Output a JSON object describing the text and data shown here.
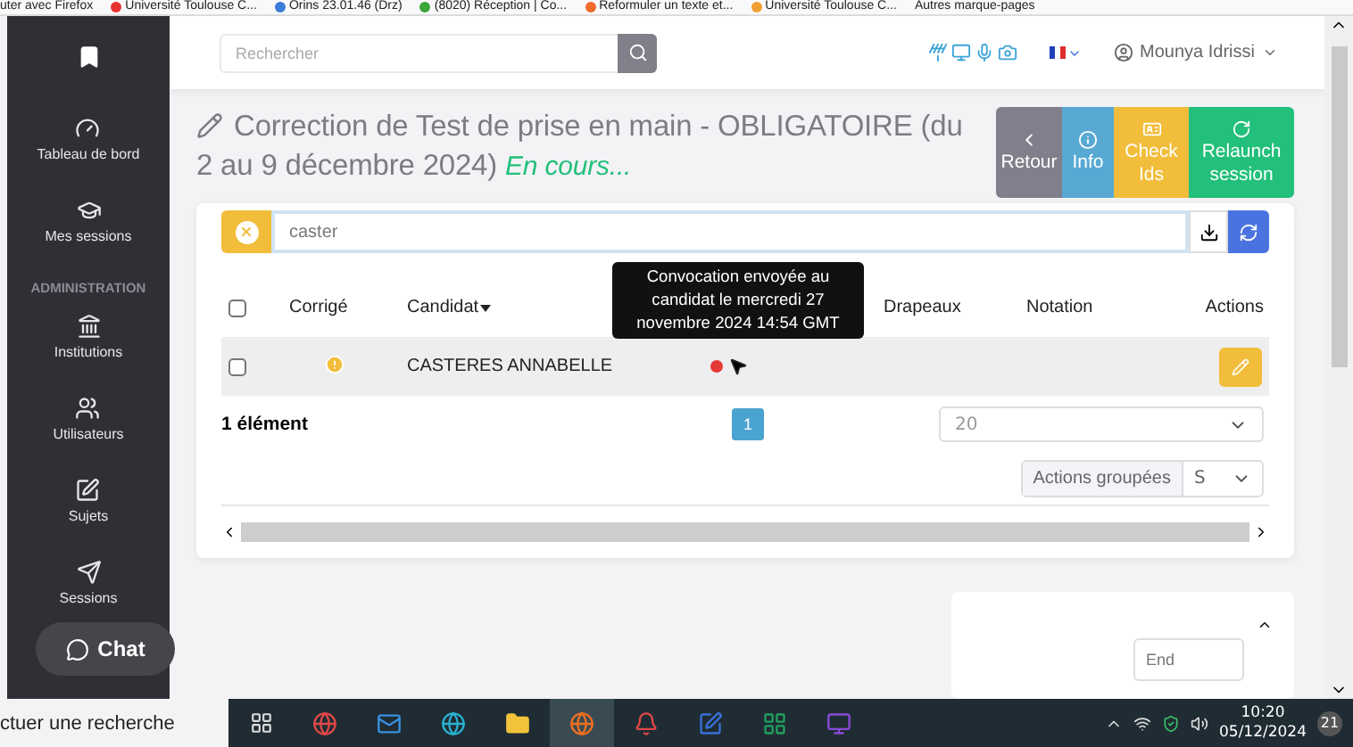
{
  "bookmarks": [
    {
      "label": "uter avec Firefox"
    },
    {
      "label": "Université Toulouse C...",
      "color": "#e5322d"
    },
    {
      "label": "Orins 23.01.46 (Drz)",
      "color": "#3b7dd8"
    },
    {
      "label": "(8020) Réception | Co...",
      "color": "#3aa63a"
    },
    {
      "label": "Reformuler un texte et...",
      "color": "#f06a2a"
    },
    {
      "label": "Université Toulouse C...",
      "color": "#f0a030"
    },
    {
      "label": "Autres marque-pages"
    }
  ],
  "header": {
    "search": {
      "placeholder": "Rechercher"
    },
    "user": "Mounya Idrissi"
  },
  "sidebar": {
    "items": [
      {
        "label": "Tableau de bord"
      },
      {
        "label": "Mes sessions"
      }
    ],
    "section": "ADMINISTRATION",
    "admin_items": [
      {
        "label": "Institutions"
      },
      {
        "label": "Utilisateurs"
      },
      {
        "label": "Sujets"
      },
      {
        "label": "Sessions"
      }
    ],
    "chat": "Chat"
  },
  "page": {
    "title": "Correction de Test de prise en main - OBLIGATOIRE (du 2 au 9 décembre 2024)",
    "status": "En cours...",
    "buttons": [
      {
        "label": "Retour",
        "kind": "back"
      },
      {
        "label": "Info",
        "kind": "info"
      },
      {
        "label": "Check Ids",
        "kind": "ids"
      },
      {
        "label": "Relaunch session",
        "kind": "relaunch"
      }
    ]
  },
  "filter": {
    "value": "caster"
  },
  "table": {
    "select_all": false,
    "columns": [
      {
        "label": "Corrigé",
        "sorted": false
      },
      {
        "label": "Candidat",
        "sorted": true
      },
      {
        "label": "Drapeaux",
        "sorted": false
      },
      {
        "label": "Notation",
        "sorted": false
      },
      {
        "label": "Actions",
        "sorted": false
      }
    ],
    "rows": [
      {
        "checked": false,
        "candidate": "CASTERES ANNABELLE"
      }
    ]
  },
  "tooltip": "Convocation envoyée au candidat le mercredi 27 novembre 2024 14:54 GMT",
  "footer": {
    "count": "1 élément",
    "pages": [
      {
        "label": "1",
        "selected": true
      }
    ],
    "page_size": "20",
    "bulk_label": "Actions groupées",
    "bulk_value": "S"
  },
  "side_card": {
    "placeholder": "End"
  },
  "taskbar": {
    "search": "ctuer une recherche",
    "time": "10:20",
    "date": "05/12/2024",
    "notifications": "21"
  }
}
